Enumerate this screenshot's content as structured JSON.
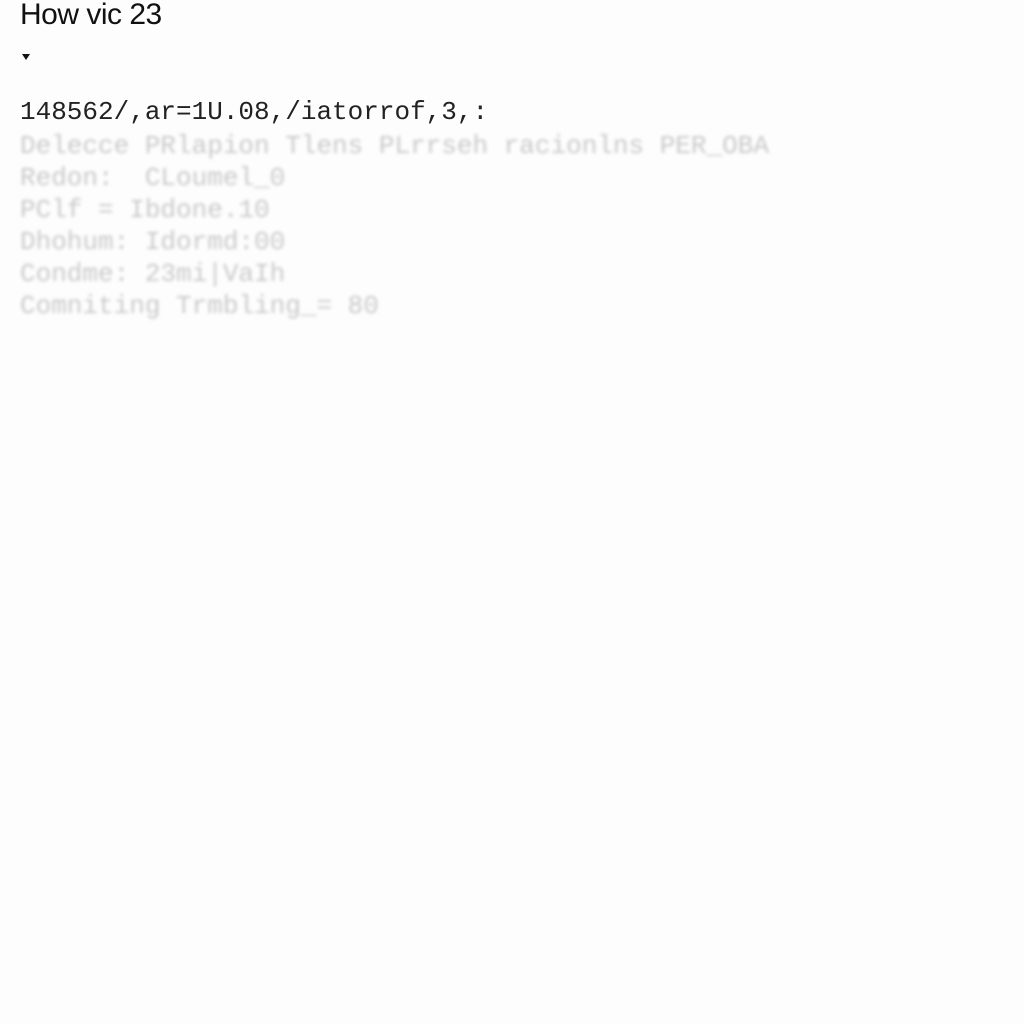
{
  "header": {
    "title": "How vic 23",
    "toggle_icon": "caret-down-icon"
  },
  "output": {
    "main_line": "148562/,ar=1U.08,/iatorrof,3,:",
    "faded_lines": [
      "Delecce PRlapion Tlens PLrrseh racionlns PER_OBA",
      "Redon:  CLoumel_0",
      "PClf = Ibdone.10",
      "Dhohum: Idormd:00",
      "Condme: 23mi|VaIh",
      "Comniting Trmbling_= 80"
    ]
  }
}
